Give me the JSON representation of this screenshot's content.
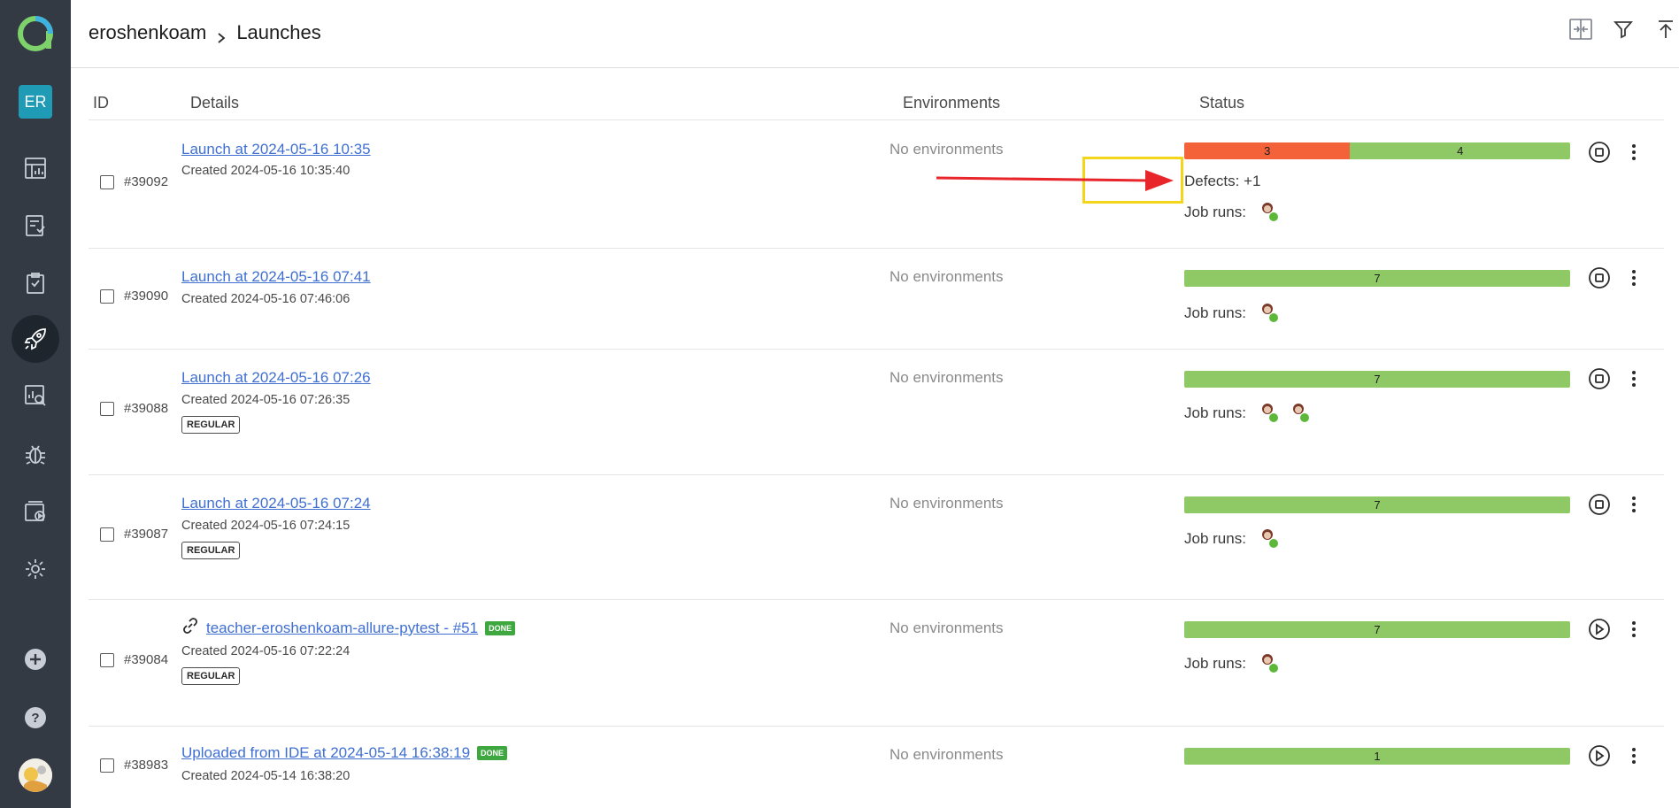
{
  "sidebar": {
    "user_initials": "ER"
  },
  "header": {
    "breadcrumb_project": "eroshenkoam",
    "breadcrumb_page": "Launches"
  },
  "table": {
    "headers": {
      "id": "ID",
      "details": "Details",
      "environments": "Environments",
      "status": "Status"
    }
  },
  "rows": [
    {
      "id": "#39092",
      "title": "Launch at 2024-05-16 10:35",
      "created": "Created 2024-05-16 10:35:40",
      "env": "No environments",
      "bar": [
        {
          "value": "3",
          "color": "#f4623a",
          "frac": 0.43
        },
        {
          "value": "4",
          "color": "#8fc965",
          "frac": 0.57
        }
      ],
      "defects_label": "Defects:",
      "defects_value": "+1",
      "job_runs_label": "Job runs:"
    },
    {
      "id": "#39090",
      "title": "Launch at 2024-05-16 07:41",
      "created": "Created 2024-05-16 07:46:06",
      "env": "No environments",
      "bar": [
        {
          "value": "7",
          "color": "#8fc965",
          "frac": 1
        }
      ],
      "job_runs_label": "Job runs:"
    },
    {
      "id": "#39088",
      "title": "Launch at 2024-05-16 07:26",
      "created": "Created 2024-05-16 07:26:35",
      "tag": "REGULAR",
      "env": "No environments",
      "bar": [
        {
          "value": "7",
          "color": "#8fc965",
          "frac": 1
        }
      ],
      "job_runs_label": "Job runs:"
    },
    {
      "id": "#39087",
      "title": "Launch at 2024-05-16 07:24",
      "created": "Created 2024-05-16 07:24:15",
      "tag": "REGULAR",
      "env": "No environments",
      "bar": [
        {
          "value": "7",
          "color": "#8fc965",
          "frac": 1
        }
      ],
      "job_runs_label": "Job runs:"
    },
    {
      "id": "#39084",
      "title": "teacher-eroshenkoam-allure-pytest - #51",
      "done": "DONE",
      "created": "Created 2024-05-16 07:22:24",
      "tag": "REGULAR",
      "env": "No environments",
      "bar": [
        {
          "value": "7",
          "color": "#8fc965",
          "frac": 1
        }
      ],
      "job_runs_label": "Job runs:"
    },
    {
      "id": "#38983",
      "title": "Uploaded from IDE at 2024-05-14 16:38:19",
      "done": "DONE",
      "created": "Created 2024-05-14 16:38:20",
      "env": "No environments",
      "bar": [
        {
          "value": "1",
          "color": "#8fc965",
          "frac": 1
        }
      ]
    }
  ],
  "colors": {
    "sidebar_bg": "#343a44",
    "accent": "#1f9bb5",
    "failed": "#f4623a",
    "passed": "#8fc965",
    "link": "#3f6fd1",
    "highlight": "#f3d61a",
    "arrow": "#e8252a"
  }
}
